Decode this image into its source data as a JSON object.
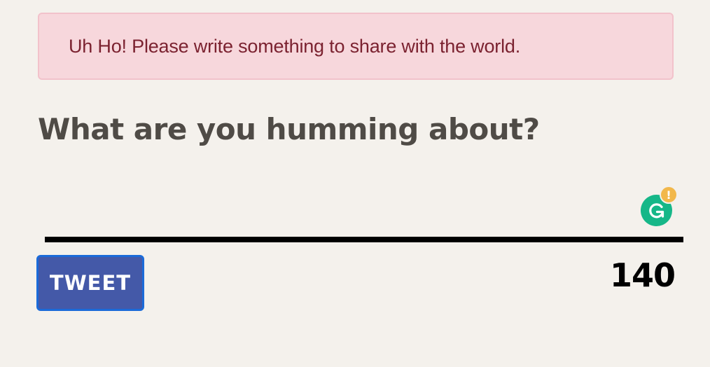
{
  "alert": {
    "message": "Uh Ho! Please write something to share with the world."
  },
  "composer": {
    "heading": "What are you humming about?",
    "value": "",
    "placeholder": ""
  },
  "actions": {
    "tweet_label": "TWEET",
    "char_count": "140"
  },
  "icons": {
    "grammarly": "grammarly-icon",
    "grammarly_badge": "!"
  },
  "colors": {
    "background": "#f4f1ec",
    "alert_bg": "#f7d7dc",
    "alert_text": "#7b2230",
    "tweet_button": "#4459a8",
    "tweet_border": "#1b6bd9",
    "grammarly": "#16b788",
    "badge": "#f2b84b"
  }
}
